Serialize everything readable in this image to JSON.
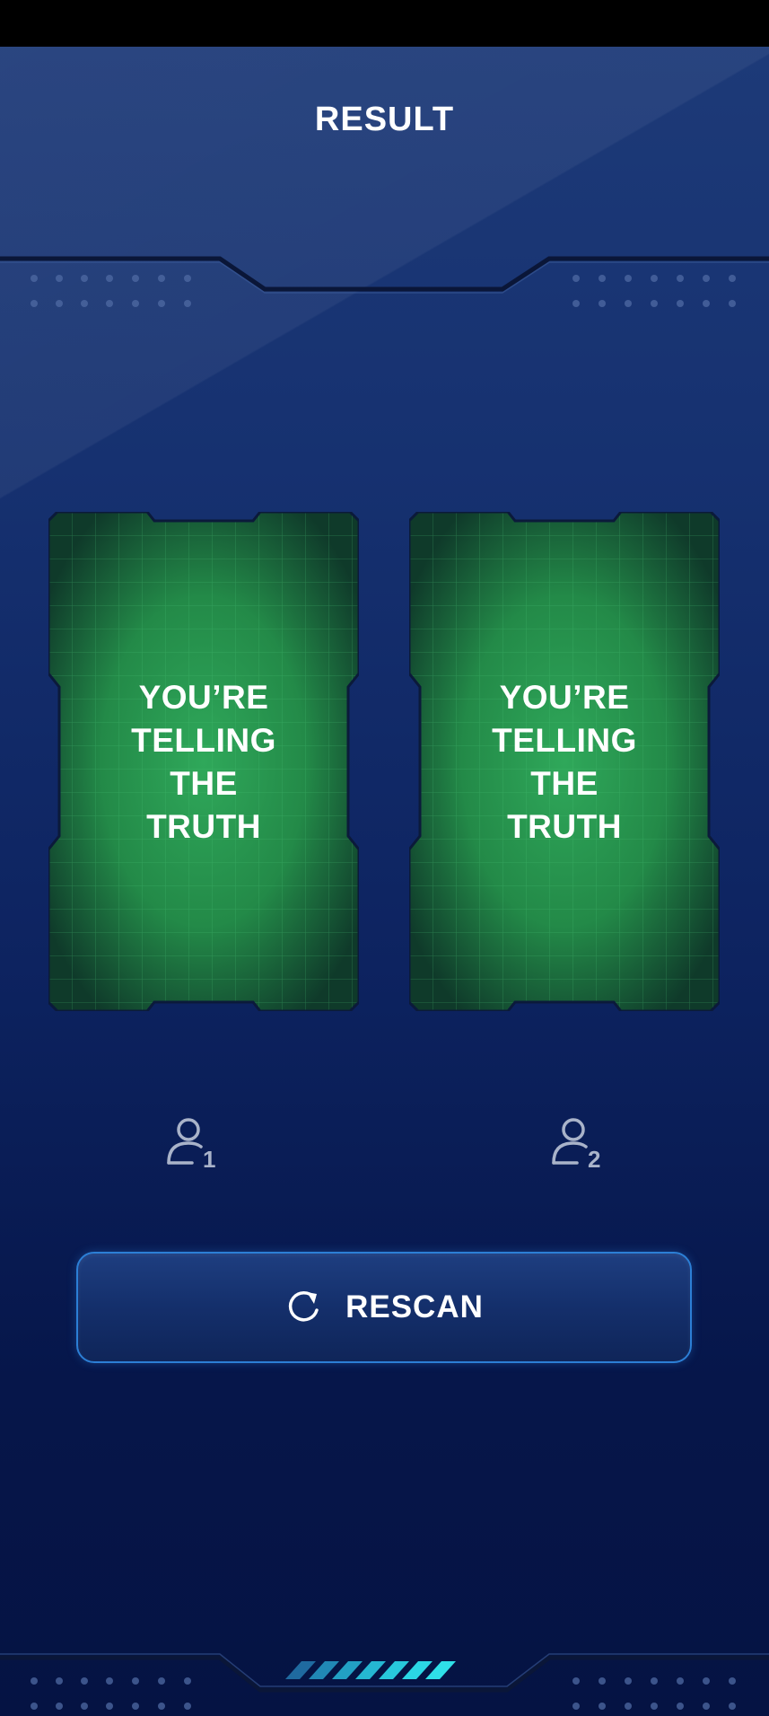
{
  "header": {
    "title": "RESULT"
  },
  "results": [
    {
      "player": "1",
      "line1": "YOU’RE",
      "line2": "TELLING",
      "line3": "THE",
      "line4": "TRUTH"
    },
    {
      "player": "2",
      "line1": "YOU’RE",
      "line2": "TELLING",
      "line3": "THE",
      "line4": "TRUTH"
    }
  ],
  "actions": {
    "rescan_label": "RESCAN",
    "rescan_icon": "refresh-icon"
  },
  "colors": {
    "background_top": "#1d3a78",
    "background_bottom": "#051343",
    "card_green": "#2a9a52",
    "button_border": "#2c7fd6",
    "accent_cyan": "#2fe0e8"
  }
}
